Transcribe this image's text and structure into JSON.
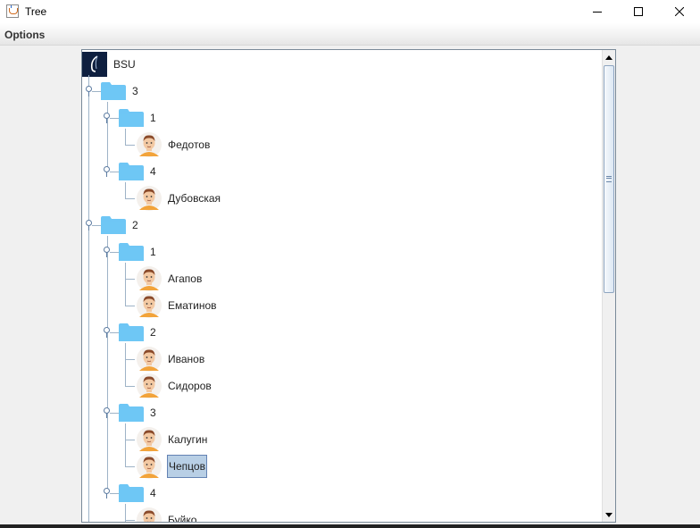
{
  "window": {
    "title": "Tree",
    "controls": [
      "minimize-icon",
      "maximize-icon",
      "close-icon"
    ]
  },
  "menubar": {
    "items": [
      {
        "label": "Options"
      }
    ]
  },
  "tree": {
    "root": {
      "label": "BSU",
      "icon": "university-logo-icon"
    },
    "rows": [
      {
        "label": "3",
        "kind": "folder",
        "depth": 1
      },
      {
        "label": "1",
        "kind": "folder",
        "depth": 2
      },
      {
        "label": "Федотов",
        "kind": "person",
        "depth": 3
      },
      {
        "label": "4",
        "kind": "folder",
        "depth": 2
      },
      {
        "label": "Дубовская",
        "kind": "person",
        "depth": 3
      },
      {
        "label": "2",
        "kind": "folder",
        "depth": 1
      },
      {
        "label": "1",
        "kind": "folder",
        "depth": 2
      },
      {
        "label": "Агапов",
        "kind": "person",
        "depth": 3
      },
      {
        "label": "Ематинов",
        "kind": "person",
        "depth": 3
      },
      {
        "label": "2",
        "kind": "folder",
        "depth": 2
      },
      {
        "label": "Иванов",
        "kind": "person",
        "depth": 3
      },
      {
        "label": "Сидоров",
        "kind": "person",
        "depth": 3
      },
      {
        "label": "3",
        "kind": "folder",
        "depth": 2
      },
      {
        "label": "Калугин",
        "kind": "person",
        "depth": 3
      },
      {
        "label": "Чепцов",
        "kind": "person",
        "depth": 3,
        "selected": true
      },
      {
        "label": "4",
        "kind": "folder",
        "depth": 2
      },
      {
        "label": "Буйко",
        "kind": "person",
        "depth": 3
      }
    ]
  },
  "colors": {
    "folder": "#6ec6f5",
    "selection": "#b8cfe5",
    "avatar_skin": "#f3c9a3",
    "avatar_shirt": "#f2a33a"
  }
}
